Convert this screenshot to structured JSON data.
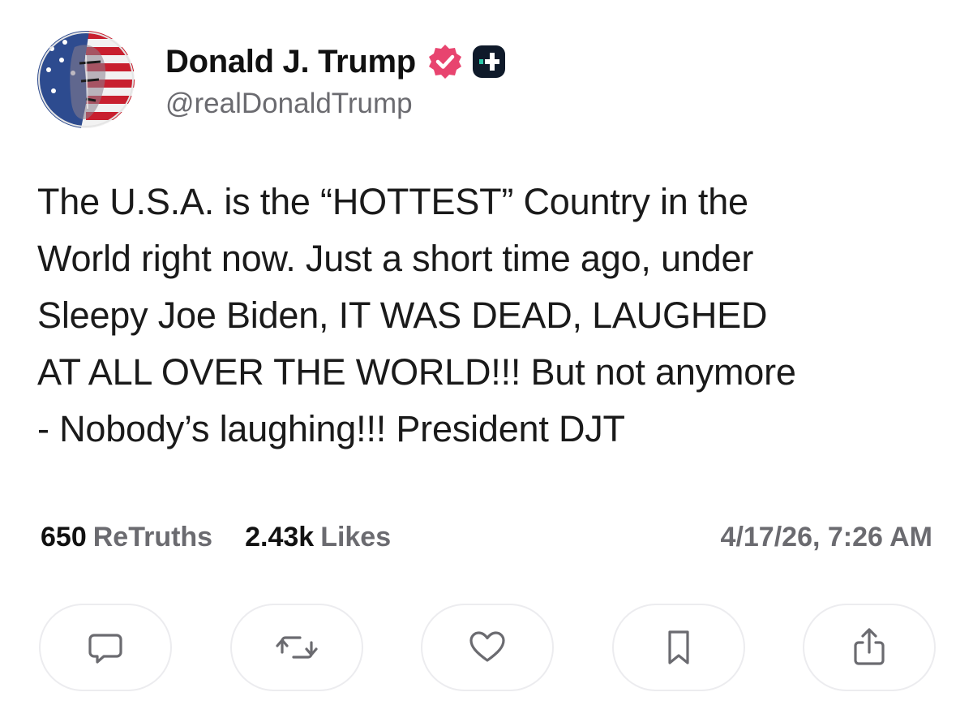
{
  "author": {
    "display_name": "Donald J. Trump",
    "handle": "@realDonaldTrump",
    "avatar_icon": "flag-portrait-avatar",
    "verified_icon": "verified-badge-icon",
    "verified_color": "#e8446f",
    "plus_badge_icon": "plus-badge-icon"
  },
  "post": {
    "text": "The U.S.A. is the “HOTTEST” Country in the\nWorld right now. Just a short time ago, under\nSleepy Joe Biden, IT WAS DEAD, LAUGHED\nAT ALL OVER THE WORLD!!! But not anymore\n- Nobody’s laughing!!! President DJT"
  },
  "stats": {
    "retruths_count": "650",
    "retruths_label": "ReTruths",
    "likes_count": "2.43k",
    "likes_label": "Likes",
    "timestamp": "4/17/26, 7:26 AM"
  },
  "actions": [
    {
      "icon": "reply-icon"
    },
    {
      "icon": "retruth-icon"
    },
    {
      "icon": "like-icon"
    },
    {
      "icon": "bookmark-icon"
    },
    {
      "icon": "share-icon"
    }
  ],
  "colors": {
    "text_primary": "#111111",
    "text_secondary": "#6b6b70",
    "button_border": "#ececef"
  }
}
